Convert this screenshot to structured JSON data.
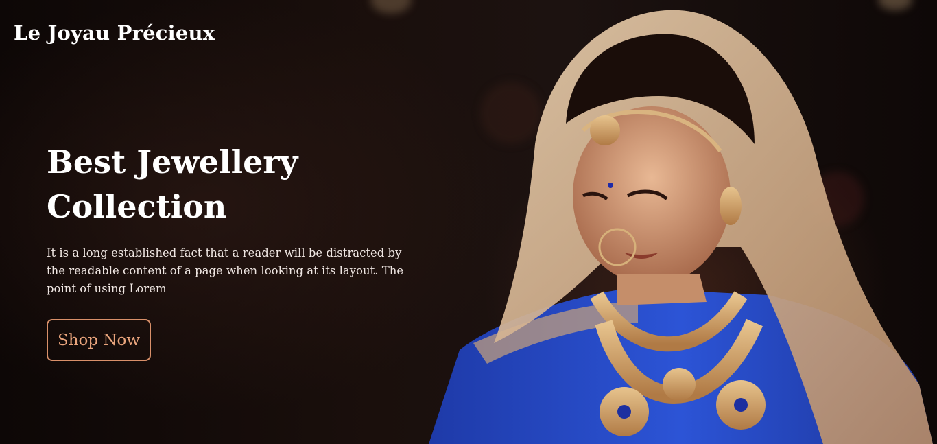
{
  "header": {
    "brand": "Le Joyau Précieux"
  },
  "hero": {
    "title_line1": "Best Jewellery",
    "title_line2": "Collection",
    "text": "It is a long established fact that a reader will be distracted by the readable content of a page when looking at its layout. The point of using Lorem",
    "cta_label": "Shop Now"
  },
  "colors": {
    "accent": "#d9906a",
    "background": "#0c0605",
    "text": "#ffffff"
  }
}
